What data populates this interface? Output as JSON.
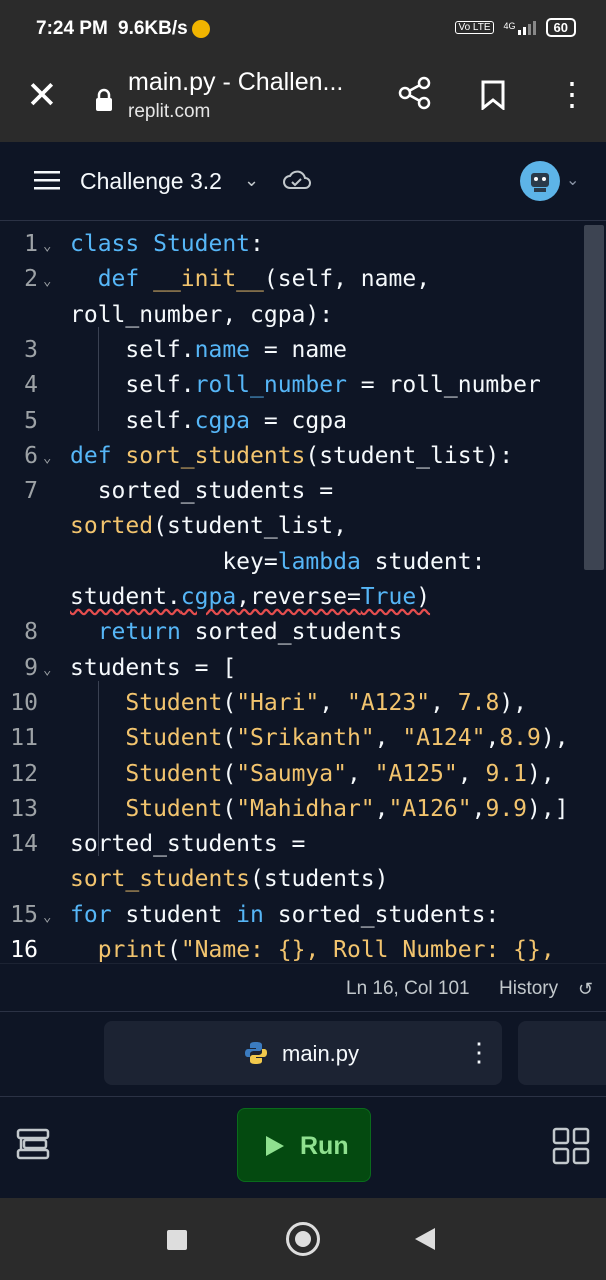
{
  "status_bar": {
    "time": "7:24 PM",
    "speed": "9.6KB/s",
    "network": "4G",
    "volte": "Vo LTE",
    "battery": "60"
  },
  "browser": {
    "title": "main.py - Challen...",
    "url": "replit.com"
  },
  "repl": {
    "name": "Challenge 3.2"
  },
  "editor": {
    "lines": [
      {
        "n": "1",
        "fold": true,
        "tokens": [
          [
            "kw",
            "class "
          ],
          [
            "kw",
            "Student"
          ],
          [
            "",
            ":"
          ]
        ]
      },
      {
        "n": "2",
        "fold": true,
        "tokens": [
          [
            "",
            "  "
          ],
          [
            "kw",
            "def "
          ],
          [
            "fn",
            "__init__"
          ],
          [
            "",
            "(self, name,"
          ]
        ]
      },
      {
        "n": "",
        "fold": false,
        "tokens": [
          [
            "",
            "roll_number, cgpa):"
          ]
        ]
      },
      {
        "n": "3",
        "fold": false,
        "tokens": [
          [
            "",
            "    self."
          ],
          [
            "prop",
            "name"
          ],
          [
            "",
            " = name"
          ]
        ]
      },
      {
        "n": "4",
        "fold": false,
        "tokens": [
          [
            "",
            "    self."
          ],
          [
            "prop",
            "roll_number"
          ],
          [
            "",
            " = roll_number"
          ]
        ]
      },
      {
        "n": "5",
        "fold": false,
        "tokens": [
          [
            "",
            "    self."
          ],
          [
            "prop",
            "cgpa"
          ],
          [
            "",
            " = cgpa"
          ]
        ]
      },
      {
        "n": "6",
        "fold": true,
        "tokens": [
          [
            "kw",
            "def "
          ],
          [
            "fn",
            "sort_students"
          ],
          [
            "",
            "(student_list):"
          ]
        ]
      },
      {
        "n": "7",
        "fold": false,
        "tokens": [
          [
            "",
            "  sorted_students ="
          ]
        ]
      },
      {
        "n": "",
        "fold": false,
        "tokens": [
          [
            "fn",
            "sorted"
          ],
          [
            "",
            "(student_list,"
          ]
        ]
      },
      {
        "n": "",
        "fold": false,
        "tokens": [
          [
            "",
            "           key="
          ],
          [
            "kw",
            "lambda"
          ],
          [
            "",
            " student:"
          ]
        ]
      },
      {
        "n": "",
        "fold": false,
        "tokens": [
          [
            "squig",
            "student."
          ],
          [
            "squigprop",
            "cgpa"
          ],
          [
            "squig",
            ",reverse="
          ],
          [
            "squigkw",
            "True"
          ],
          [
            "squig",
            ")"
          ]
        ]
      },
      {
        "n": "8",
        "fold": false,
        "tokens": [
          [
            "",
            "  "
          ],
          [
            "kw",
            "return"
          ],
          [
            "",
            " sorted_students"
          ]
        ]
      },
      {
        "n": "9",
        "fold": true,
        "tokens": [
          [
            "",
            "students = ["
          ]
        ]
      },
      {
        "n": "10",
        "fold": false,
        "tokens": [
          [
            "",
            "    "
          ],
          [
            "fn",
            "Student"
          ],
          [
            "",
            "("
          ],
          [
            "str",
            "\"Hari\""
          ],
          [
            "",
            ", "
          ],
          [
            "str",
            "\"A123\""
          ],
          [
            "",
            ", "
          ],
          [
            "num",
            "7.8"
          ],
          [
            "",
            "),"
          ]
        ]
      },
      {
        "n": "11",
        "fold": false,
        "tokens": [
          [
            "",
            "    "
          ],
          [
            "fn",
            "Student"
          ],
          [
            "",
            "("
          ],
          [
            "str",
            "\"Srikanth\""
          ],
          [
            "",
            ", "
          ],
          [
            "str",
            "\"A124\""
          ],
          [
            "",
            ","
          ],
          [
            "num",
            "8.9"
          ],
          [
            "",
            "),"
          ]
        ]
      },
      {
        "n": "12",
        "fold": false,
        "tokens": [
          [
            "",
            "    "
          ],
          [
            "fn",
            "Student"
          ],
          [
            "",
            "("
          ],
          [
            "str",
            "\"Saumya\""
          ],
          [
            "",
            ", "
          ],
          [
            "str",
            "\"A125\""
          ],
          [
            "",
            ", "
          ],
          [
            "num",
            "9.1"
          ],
          [
            "",
            "),"
          ]
        ]
      },
      {
        "n": "13",
        "fold": false,
        "tokens": [
          [
            "",
            "    "
          ],
          [
            "fn",
            "Student"
          ],
          [
            "",
            "("
          ],
          [
            "str",
            "\"Mahidhar\""
          ],
          [
            "",
            ","
          ],
          [
            "str",
            "\"A126\""
          ],
          [
            "",
            ","
          ],
          [
            "num",
            "9.9"
          ],
          [
            "",
            "),]"
          ]
        ]
      },
      {
        "n": "14",
        "fold": false,
        "tokens": [
          [
            "",
            "sorted_students ="
          ]
        ]
      },
      {
        "n": "",
        "fold": false,
        "tokens": [
          [
            "fn",
            "sort_students"
          ],
          [
            "",
            "(students)"
          ]
        ]
      },
      {
        "n": "15",
        "fold": true,
        "tokens": [
          [
            "kw",
            "for"
          ],
          [
            "",
            " student "
          ],
          [
            "kw",
            "in"
          ],
          [
            "",
            " sorted_students:"
          ]
        ]
      },
      {
        "n": "16",
        "fold": false,
        "active": true,
        "tokens": [
          [
            "",
            "  "
          ],
          [
            "fn",
            "print"
          ],
          [
            "",
            "("
          ],
          [
            "str",
            "\"Name: {}, Roll Number: {},"
          ]
        ]
      }
    ]
  },
  "statusline": {
    "position": "Ln 16, Col 101",
    "history": "History"
  },
  "tab": {
    "label": "main.py"
  },
  "toolbar": {
    "run_label": "Run"
  }
}
